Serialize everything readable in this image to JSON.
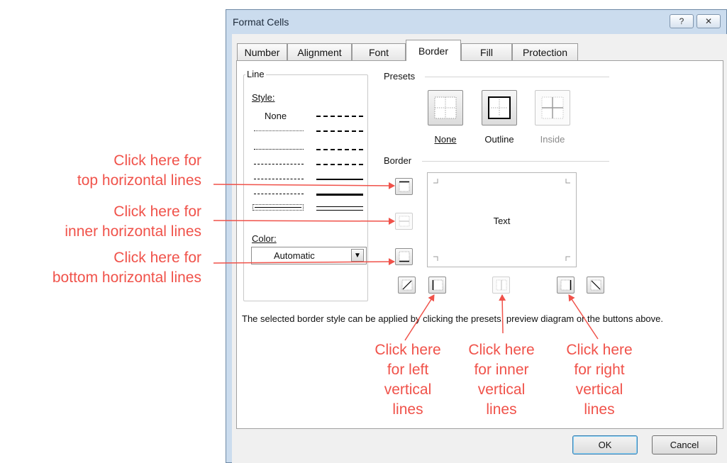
{
  "window": {
    "title": "Format Cells",
    "help_glyph": "?",
    "close_glyph": "✕"
  },
  "tabs": [
    {
      "label": "Number"
    },
    {
      "label": "Alignment"
    },
    {
      "label": "Font"
    },
    {
      "label": "Border",
      "active": true
    },
    {
      "label": "Fill"
    },
    {
      "label": "Protection"
    }
  ],
  "line": {
    "group_label": "Line",
    "style_label": "Style:",
    "none_label": "None",
    "color_label": "Color:",
    "color_value": "Automatic",
    "dropdown_glyph": "▼"
  },
  "presets": {
    "group_label": "Presets",
    "items": [
      {
        "label": "None",
        "icon": "preset-none-icon"
      },
      {
        "label": "Outline",
        "icon": "preset-outline-icon"
      },
      {
        "label": "Inside",
        "icon": "preset-inside-icon",
        "disabled": true
      }
    ]
  },
  "border": {
    "group_label": "Border",
    "preview_text": "Text"
  },
  "hint": "The selected border style can be applied by clicking the presets, preview diagram or the buttons above.",
  "buttons": {
    "ok": "OK",
    "cancel": "Cancel"
  },
  "annotations": {
    "top": [
      "Click here for",
      "top horizontal lines"
    ],
    "inner_h": [
      "Click here for",
      "inner horizontal lines"
    ],
    "bottom": [
      "Click here for",
      "bottom horizontal lines"
    ],
    "left_v": [
      "Click here",
      "for left",
      "vertical",
      "lines"
    ],
    "inner_v": [
      "Click here",
      "for inner",
      "vertical",
      "lines"
    ],
    "right_v": [
      "Click here",
      "for right",
      "vertical",
      "lines"
    ],
    "color": "#f0524a"
  }
}
